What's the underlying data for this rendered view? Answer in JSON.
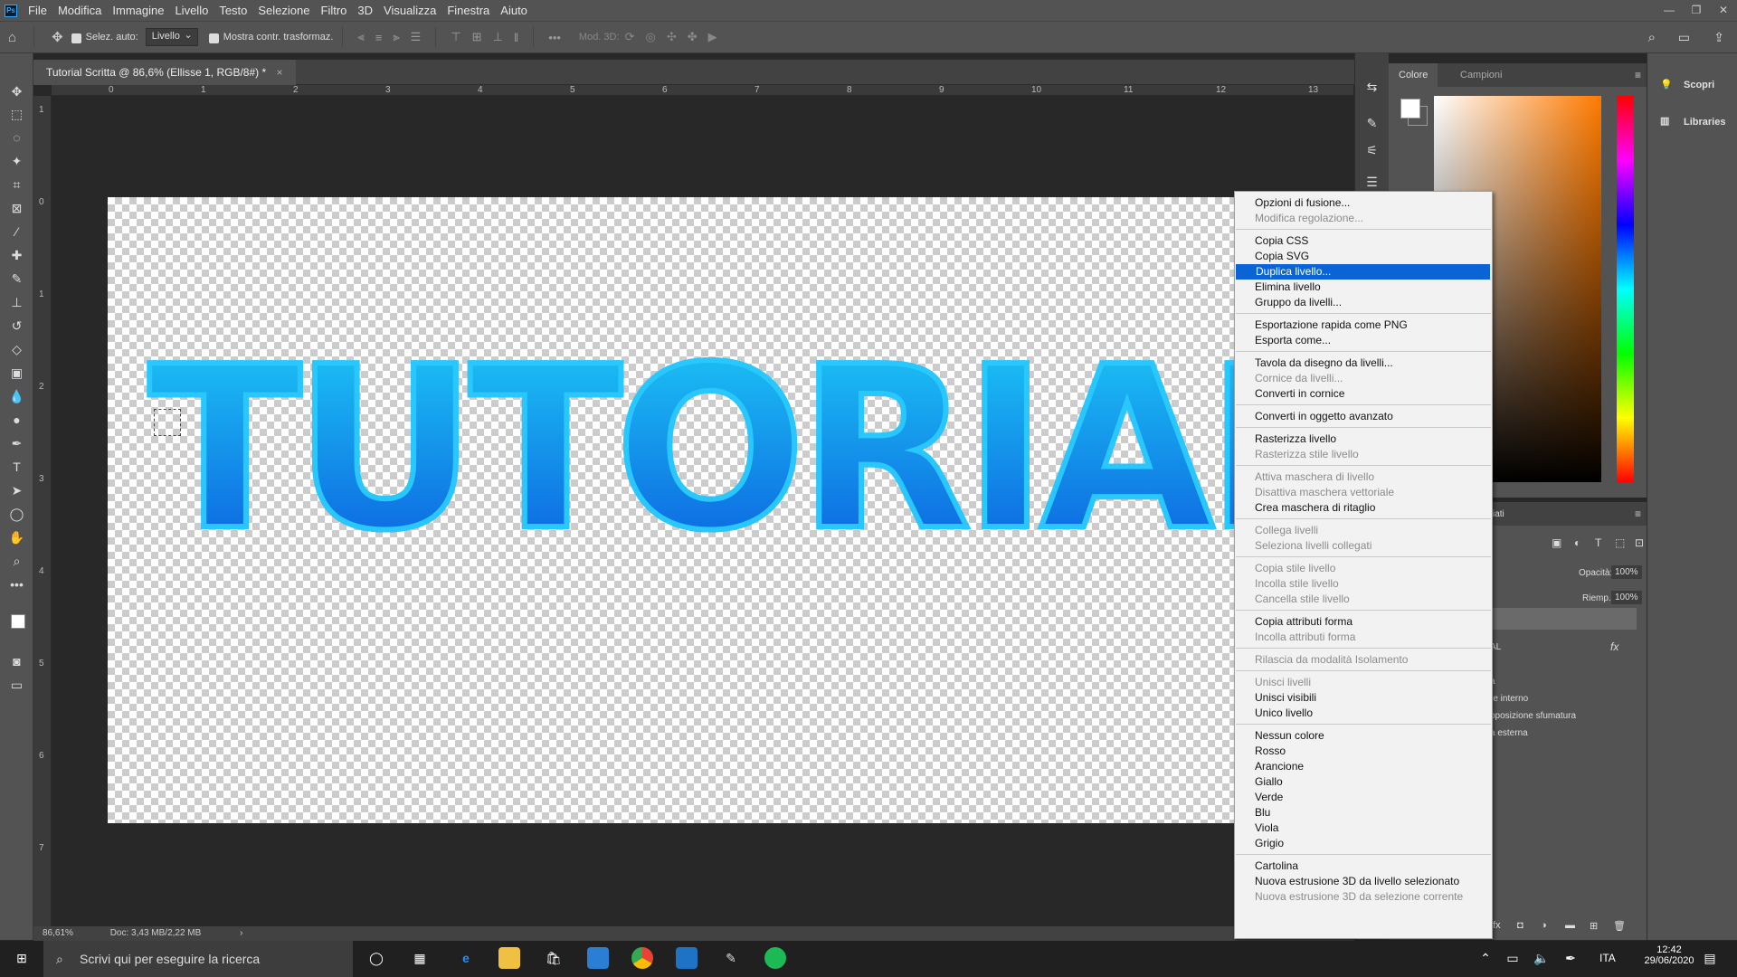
{
  "app": {
    "icon": "ps-logo-icon",
    "logo_text": "Ps"
  },
  "menubar": [
    "File",
    "Modifica",
    "Immagine",
    "Livello",
    "Testo",
    "Selezione",
    "Filtro",
    "3D",
    "Visualizza",
    "Finestra",
    "Aiuto"
  ],
  "options": {
    "auto_select": "Selez. auto:",
    "auto_select_value": "Livello",
    "show_transform": "Mostra contr. trasformaz.",
    "mode_3d": "Mod. 3D:"
  },
  "document": {
    "tab_title": "Tutorial Scritta @ 86,6% (Ellisse 1, RGB/8#) *",
    "canvas_text": "TUTORIAL",
    "zoom": "86,61%",
    "doc_info": "Doc: 3,43 MB/2,22 MB"
  },
  "ruler": {
    "top": [
      "0",
      "1",
      "2",
      "3",
      "4",
      "5",
      "6",
      "7",
      "8",
      "9",
      "10",
      "11",
      "12",
      "13"
    ],
    "left": [
      "1",
      "0",
      "1",
      "2",
      "3",
      "4",
      "5",
      "6",
      "7"
    ]
  },
  "color_panel": {
    "tab_color": "Colore",
    "tab_swatches": "Campioni"
  },
  "layers_panel": {
    "tab_partial": "cciati",
    "opacity_label": "Opacità:",
    "opacity_value": "100%",
    "fill_label": "Riemp.:",
    "fill_value": "100%",
    "layer_name_partial": "AL",
    "fx": "fx",
    "effects": [
      "a",
      "re interno",
      "pposizione sfumatura",
      "a esterna"
    ]
  },
  "right_panel": {
    "discover": "Scopri",
    "libraries": "Libraries"
  },
  "context_menu": {
    "items": [
      {
        "label": "Opzioni di fusione...",
        "enabled": true
      },
      {
        "label": "Modifica regolazione...",
        "enabled": false
      },
      {
        "sep": true
      },
      {
        "label": "Copia CSS",
        "enabled": true
      },
      {
        "label": "Copia SVG",
        "enabled": true
      },
      {
        "label": "Duplica livello...",
        "enabled": true,
        "highlighted": true
      },
      {
        "label": "Elimina livello",
        "enabled": true
      },
      {
        "label": "Gruppo da livelli...",
        "enabled": true
      },
      {
        "sep": true
      },
      {
        "label": "Esportazione rapida come PNG",
        "enabled": true
      },
      {
        "label": "Esporta come...",
        "enabled": true
      },
      {
        "sep": true
      },
      {
        "label": "Tavola da disegno da livelli...",
        "enabled": true
      },
      {
        "label": "Cornice da livelli...",
        "enabled": false
      },
      {
        "label": "Converti in cornice",
        "enabled": true
      },
      {
        "sep": true
      },
      {
        "label": "Converti in oggetto avanzato",
        "enabled": true
      },
      {
        "sep": true
      },
      {
        "label": "Rasterizza livello",
        "enabled": true
      },
      {
        "label": "Rasterizza stile livello",
        "enabled": false
      },
      {
        "sep": true
      },
      {
        "label": "Attiva maschera di livello",
        "enabled": false
      },
      {
        "label": "Disattiva maschera vettoriale",
        "enabled": false
      },
      {
        "label": "Crea maschera di ritaglio",
        "enabled": true
      },
      {
        "sep": true
      },
      {
        "label": "Collega livelli",
        "enabled": false
      },
      {
        "label": "Seleziona livelli collegati",
        "enabled": false
      },
      {
        "sep": true
      },
      {
        "label": "Copia stile livello",
        "enabled": false
      },
      {
        "label": "Incolla stile livello",
        "enabled": false
      },
      {
        "label": "Cancella stile livello",
        "enabled": false
      },
      {
        "sep": true
      },
      {
        "label": "Copia attributi forma",
        "enabled": true
      },
      {
        "label": "Incolla attributi forma",
        "enabled": false
      },
      {
        "sep": true
      },
      {
        "label": "Rilascia da modalità Isolamento",
        "enabled": false
      },
      {
        "sep": true
      },
      {
        "label": "Unisci livelli",
        "enabled": false
      },
      {
        "label": "Unisci visibili",
        "enabled": true
      },
      {
        "label": "Unico livello",
        "enabled": true
      },
      {
        "sep": true
      },
      {
        "label": "Nessun colore",
        "enabled": true
      },
      {
        "label": "Rosso",
        "enabled": true
      },
      {
        "label": "Arancione",
        "enabled": true
      },
      {
        "label": "Giallo",
        "enabled": true
      },
      {
        "label": "Verde",
        "enabled": true
      },
      {
        "label": "Blu",
        "enabled": true
      },
      {
        "label": "Viola",
        "enabled": true
      },
      {
        "label": "Grigio",
        "enabled": true
      },
      {
        "sep": true
      },
      {
        "label": "Cartolina",
        "enabled": true
      },
      {
        "label": "Nuova estrusione 3D da livello selezionato",
        "enabled": true
      },
      {
        "label": "Nuova estrusione 3D da selezione corrente",
        "enabled": false
      }
    ]
  },
  "taskbar": {
    "search_placeholder": "Scrivi qui per eseguire la ricerca",
    "lang": "ITA",
    "time": "12:42",
    "date": "29/06/2020"
  },
  "colors": {
    "accent": "#0a64d6",
    "text_top": "#1cc5f5",
    "text_bottom": "#0c61e0"
  }
}
